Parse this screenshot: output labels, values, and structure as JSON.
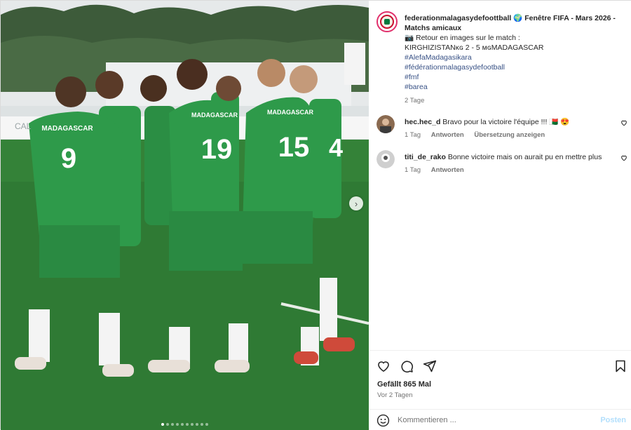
{
  "post": {
    "username": "federationmalagasydefoottball",
    "caption_title": "🌍 Fenêtre FIFA - Mars 2026 - Matchs amicaux",
    "caption_line1": "📷 Retour en images sur le match :",
    "caption_line2": "KIRGHIZISTANᴋɢ 2 - 5 ᴍɢMADAGASCAR",
    "hashtags": [
      "#AlefaMadagasikara",
      "#fédérationmalagasydefootball",
      "#fmf",
      "#barea"
    ],
    "time": "2 Tage"
  },
  "image": {
    "team_name": "MADAGASCAR",
    "numbers": [
      "9",
      "19",
      "15",
      "4"
    ],
    "banner_text": "CAL",
    "carousel_count": 10,
    "carousel_active": 0,
    "colors": {
      "kit": "#2e9a4a",
      "pitch": "#2f7a34",
      "sky": "#e6e9ea",
      "trees": "#3d5b3a"
    }
  },
  "comments": [
    {
      "username": "hec.hec_d",
      "text": "Bravo pour la victoire l'équipe !!! 🇲🇬 😍",
      "time": "1 Tag",
      "reply": "Antworten",
      "translate": "Übersetzung anzeigen"
    },
    {
      "username": "titi_de_rako",
      "text": "Bonne victoire mais on aurait pu en mettre plus",
      "time": "1 Tag",
      "reply": "Antworten"
    }
  ],
  "actions": {
    "likes": "Gefällt 865 Mal",
    "date": "Vor 2 Tagen",
    "icons": [
      "heart-icon",
      "comment-icon",
      "share-icon",
      "bookmark-icon"
    ]
  },
  "comment_box": {
    "placeholder": "Kommentieren ...",
    "post_label": "Posten"
  }
}
